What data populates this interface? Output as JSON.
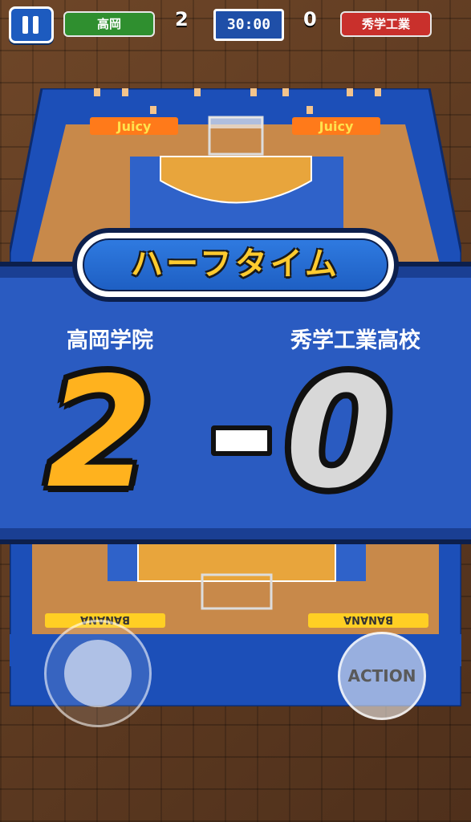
{
  "hud": {
    "team_a": "高岡",
    "team_b": "秀学工業",
    "score_a": "2",
    "score_b": "0",
    "timer": "30:00"
  },
  "banner": {
    "title": "ハーフタイム",
    "team_a_full": "高岡学院",
    "team_b_full": "秀学工業高校",
    "score_a": "2",
    "score_b": "0"
  },
  "court": {
    "sponsor_top": "Juicy",
    "sponsor_bottom": "BANANA"
  },
  "controls": {
    "action_label": "ACTION"
  },
  "colors": {
    "team_a": "#2f8f2f",
    "team_b": "#c9302c",
    "banner": "#2a5bc1",
    "court": "#c8894a",
    "paint": "#e8a53c"
  }
}
